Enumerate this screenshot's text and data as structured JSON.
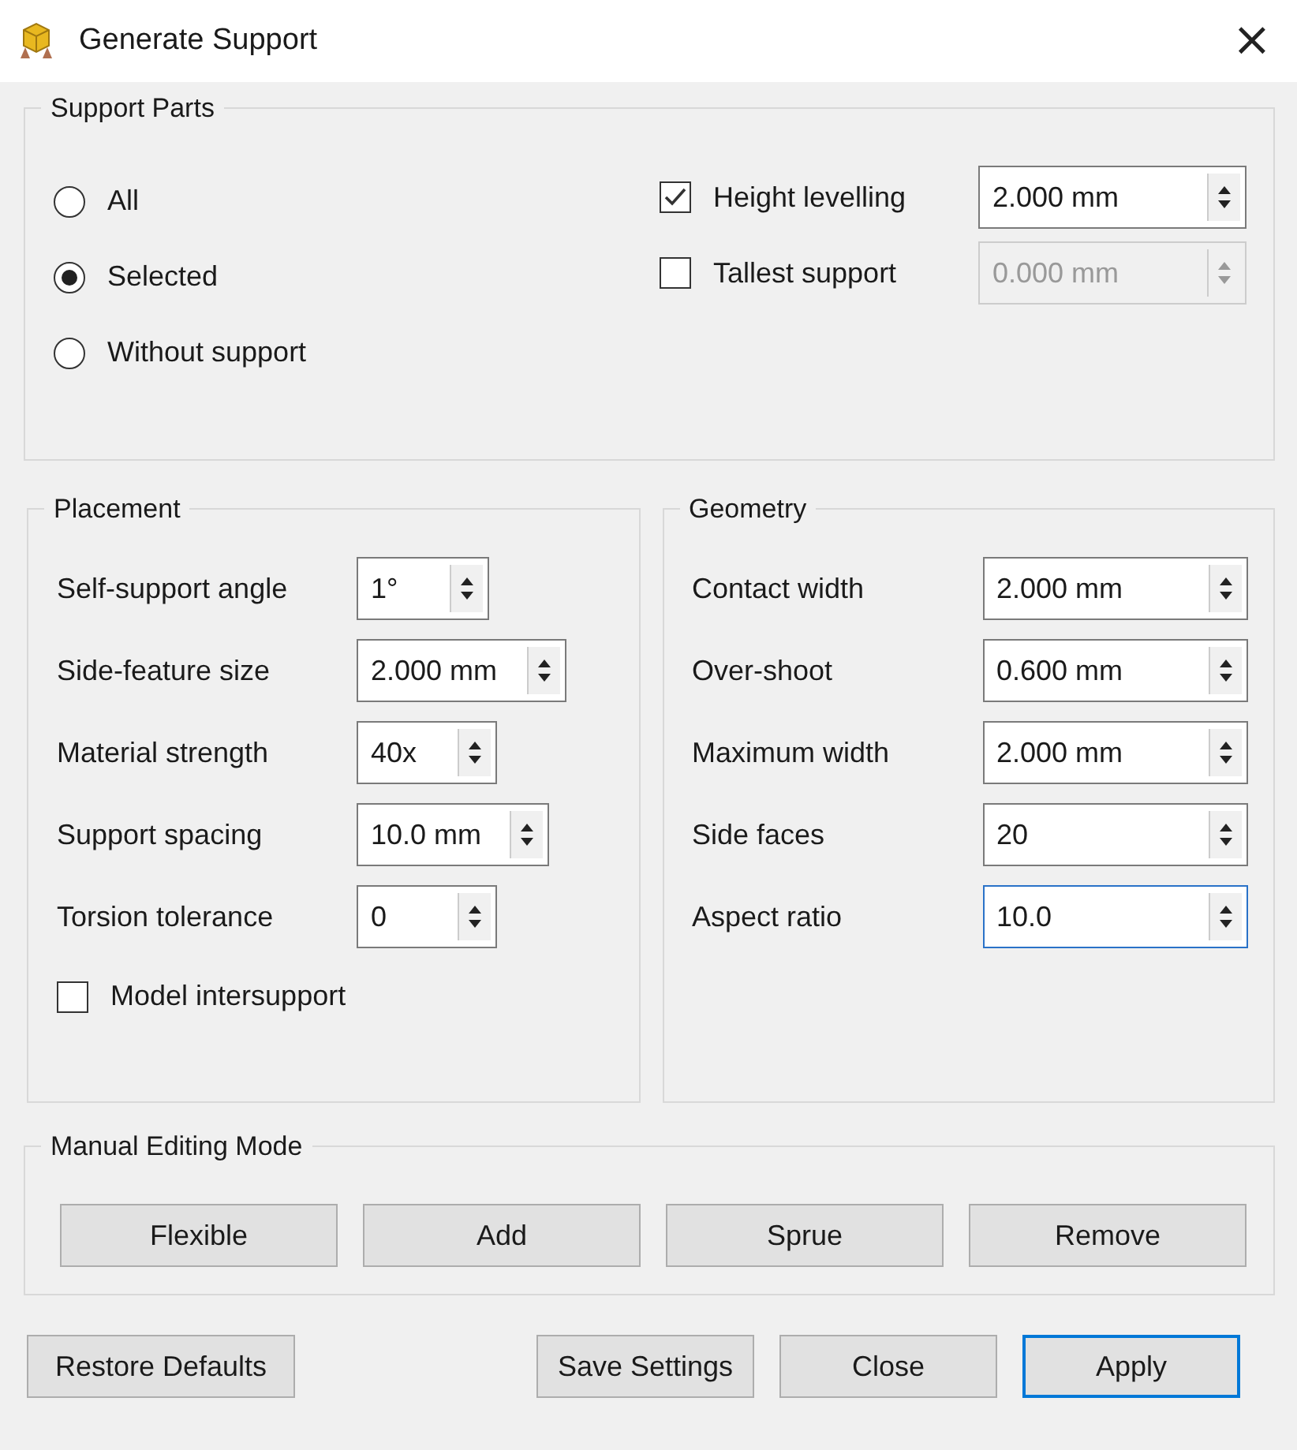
{
  "window": {
    "title": "Generate Support",
    "close": "×"
  },
  "support_parts": {
    "title": "Support Parts",
    "radios": [
      {
        "label": "All",
        "selected": false
      },
      {
        "label": "Selected",
        "selected": true
      },
      {
        "label": "Without support",
        "selected": false
      }
    ],
    "options": [
      {
        "label": "Height levelling",
        "checked": true,
        "value": "2.000 mm",
        "disabled": false
      },
      {
        "label": "Tallest support",
        "checked": false,
        "value": "0.000 mm",
        "disabled": true
      }
    ]
  },
  "placement": {
    "title": "Placement",
    "fields": [
      {
        "label": "Self-support angle",
        "value": "1°"
      },
      {
        "label": "Side-feature size",
        "value": "2.000 mm"
      },
      {
        "label": "Material strength",
        "value": "40x"
      },
      {
        "label": "Support spacing",
        "value": "10.0 mm"
      },
      {
        "label": "Torsion tolerance",
        "value": "0"
      }
    ],
    "checkbox": {
      "label": "Model intersupport",
      "checked": false
    }
  },
  "geometry": {
    "title": "Geometry",
    "fields": [
      {
        "label": "Contact width",
        "value": "2.000 mm",
        "focused": false
      },
      {
        "label": "Over-shoot",
        "value": "0.600 mm",
        "focused": false
      },
      {
        "label": "Maximum width",
        "value": "2.000 mm",
        "focused": false
      },
      {
        "label": "Side faces",
        "value": "20",
        "focused": false
      },
      {
        "label": "Aspect ratio",
        "value": "10.0",
        "focused": true
      }
    ]
  },
  "manual_editing_mode": {
    "title": "Manual Editing Mode",
    "buttons": [
      "Flexible",
      "Add",
      "Sprue",
      "Remove"
    ]
  },
  "footer_buttons": [
    {
      "label": "Restore Defaults",
      "default": false
    },
    {
      "label": "Save Settings",
      "default": false
    },
    {
      "label": "Close",
      "default": false
    },
    {
      "label": "Apply",
      "default": true
    }
  ]
}
